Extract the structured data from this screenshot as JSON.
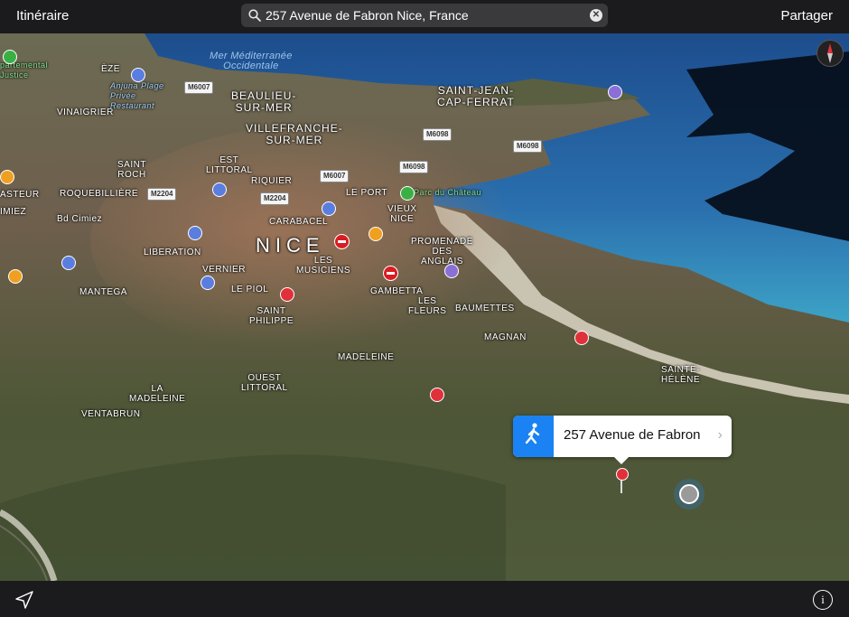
{
  "topbar": {
    "left_label": "Itinéraire",
    "right_label": "Partager",
    "search_value": "257 Avenue de Fabron Nice, France"
  },
  "map": {
    "sea_label": "Mer Méditerranée\nOccidentale",
    "city_label": "NICE",
    "districts": [
      "ÈZE",
      "BEAULIEU-\nSUR-MER",
      "SAINT-JEAN-\nCAP-FERRAT",
      "VILLEFRANCHE-\nSUR-MER",
      "VINAIGRIER",
      "SAINT\nROCH",
      "EST\nLITTORAL",
      "RIQUIER",
      "LE PORT",
      "ROQUEBILLIÈRE",
      "ASTEUR",
      "Bd Cimiez",
      "IMIEZ",
      "CARABACEL",
      "VIEUX\nNICE",
      "LIBERATION",
      "PROMENADE\nDES\nANGLAIS",
      "LES\nMUSICIENS",
      "VERNIER",
      "MANTEGA",
      "LE PIOL",
      "GAMBETTA",
      "LES\nFLEURS",
      "BAUMETTES",
      "SAINT\nPHILIPPE",
      "MAGNAN",
      "MADELEINE",
      "OUEST\nLITTORAL",
      "LA\nMADELEINE",
      "VENTABRUN",
      "SAINTE-\nHÉLÈNE"
    ],
    "roads": [
      "M6007",
      "M6098",
      "M6098",
      "M6098",
      "M6007",
      "M2204",
      "M2204"
    ],
    "pois": {
      "anjuna": "Anjuna Plage\nPrivée\nRestaurant",
      "parc": "Parc du Château",
      "departmental": "partemental\nJustice"
    },
    "callout_title": "257 Avenue de Fabron",
    "colors": {
      "callout_accent": "#1a82f2",
      "pin": "#e0313a"
    }
  },
  "icons": {
    "search": "search-icon",
    "clear": "clear-icon",
    "compass": "compass-icon",
    "walk": "walking-person-icon",
    "location": "location-arrow-icon",
    "info": "info-icon"
  }
}
